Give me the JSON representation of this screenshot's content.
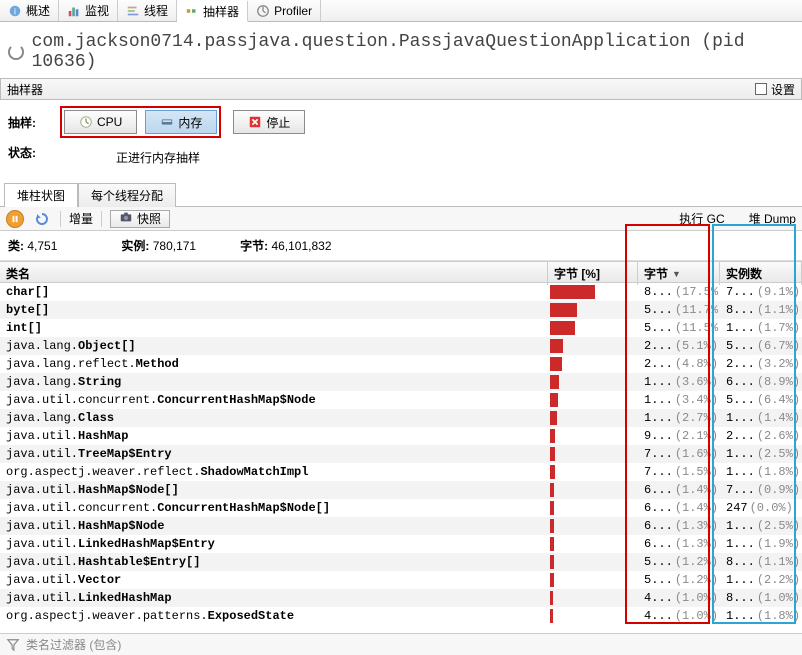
{
  "tabs": {
    "overview": "概述",
    "monitor": "监视",
    "threads": "线程",
    "sampler": "抽样器",
    "profiler": "Profiler"
  },
  "title": "com.jackson0714.passjava.question.PassjavaQuestionApplication (pid 10636)",
  "panel": {
    "name": "抽样器",
    "settings": "设置"
  },
  "controls": {
    "sample_label": "抽样:",
    "state_label": "状态:",
    "cpu": "CPU",
    "memory": "内存",
    "stop": "停止",
    "status": "正进行内存抽样"
  },
  "sub_tabs": {
    "histogram": "堆柱状图",
    "per_thread": "每个线程分配"
  },
  "toolbar": {
    "delta": "增量",
    "snapshot": "快照",
    "run_gc": "执行 GC",
    "heap_dump": "堆 Dump"
  },
  "totals": {
    "classes_label": "类:",
    "classes": "4,751",
    "instances_label": "实例:",
    "instances": "780,171",
    "bytes_label": "字节:",
    "bytes": "46,101,832"
  },
  "columns": {
    "name": "类名",
    "bytes_pct": "字节 [%]",
    "bytes": "字节",
    "instances": "实例数"
  },
  "footer": {
    "placeholder": "类名过滤器 (包含)"
  },
  "rows": [
    {
      "pkg": "",
      "cls": "char[]",
      "barPct": 50,
      "b": "8...",
      "bp": "(17.5%)",
      "i": "7...",
      "ip": "(9.1%)"
    },
    {
      "pkg": "",
      "cls": "byte[]",
      "barPct": 30,
      "b": "5...",
      "bp": "(11.7%)",
      "i": "8...",
      "ip": "(1.1%)"
    },
    {
      "pkg": "",
      "cls": "int[]",
      "barPct": 28,
      "b": "5...",
      "bp": "(11.5%)",
      "i": "1...",
      "ip": "(1.7%)"
    },
    {
      "pkg": "java.lang.",
      "cls": "Object[]",
      "barPct": 14,
      "b": "2...",
      "bp": "(5.1%)",
      "i": "5...",
      "ip": "(6.7%)"
    },
    {
      "pkg": "java.lang.reflect.",
      "cls": "Method",
      "barPct": 13,
      "b": "2...",
      "bp": "(4.8%)",
      "i": "2...",
      "ip": "(3.2%)"
    },
    {
      "pkg": "java.lang.",
      "cls": "String",
      "barPct": 10,
      "b": "1...",
      "bp": "(3.6%)",
      "i": "6...",
      "ip": "(8.9%)"
    },
    {
      "pkg": "java.util.concurrent.",
      "cls": "ConcurrentHashMap$Node",
      "barPct": 9,
      "b": "1...",
      "bp": "(3.4%)",
      "i": "5...",
      "ip": "(6.4%)"
    },
    {
      "pkg": "java.lang.",
      "cls": "Class",
      "barPct": 8,
      "b": "1...",
      "bp": "(2.7%)",
      "i": "1...",
      "ip": "(1.4%)"
    },
    {
      "pkg": "java.util.",
      "cls": "HashMap",
      "barPct": 6,
      "b": "9...",
      "bp": "(2.1%)",
      "i": "2...",
      "ip": "(2.6%)"
    },
    {
      "pkg": "java.util.",
      "cls": "TreeMap$Entry",
      "barPct": 5,
      "b": "7...",
      "bp": "(1.6%)",
      "i": "1...",
      "ip": "(2.5%)"
    },
    {
      "pkg": "org.aspectj.weaver.reflect.",
      "cls": "ShadowMatchImpl",
      "barPct": 5,
      "b": "7...",
      "bp": "(1.5%)",
      "i": "1...",
      "ip": "(1.8%)"
    },
    {
      "pkg": "java.util.",
      "cls": "HashMap$Node[]",
      "barPct": 4,
      "b": "6...",
      "bp": "(1.4%)",
      "i": "7...",
      "ip": "(0.9%)"
    },
    {
      "pkg": "java.util.concurrent.",
      "cls": "ConcurrentHashMap$Node[]",
      "barPct": 4,
      "b": "6...",
      "bp": "(1.4%)",
      "i": "247",
      "ip": "(0.0%)"
    },
    {
      "pkg": "java.util.",
      "cls": "HashMap$Node",
      "barPct": 4,
      "b": "6...",
      "bp": "(1.3%)",
      "i": "1...",
      "ip": "(2.5%)"
    },
    {
      "pkg": "java.util.",
      "cls": "LinkedHashMap$Entry",
      "barPct": 4,
      "b": "6...",
      "bp": "(1.3%)",
      "i": "1...",
      "ip": "(1.9%)"
    },
    {
      "pkg": "java.util.",
      "cls": "Hashtable$Entry[]",
      "barPct": 4,
      "b": "5...",
      "bp": "(1.2%)",
      "i": "8...",
      "ip": "(1.1%)"
    },
    {
      "pkg": "java.util.",
      "cls": "Vector",
      "barPct": 4,
      "b": "5...",
      "bp": "(1.2%)",
      "i": "1...",
      "ip": "(2.2%)"
    },
    {
      "pkg": "java.util.",
      "cls": "LinkedHashMap",
      "barPct": 3,
      "b": "4...",
      "bp": "(1.0%)",
      "i": "8...",
      "ip": "(1.0%)"
    },
    {
      "pkg": "org.aspectj.weaver.patterns.",
      "cls": "ExposedState",
      "barPct": 3,
      "b": "4...",
      "bp": "(1.0%)",
      "i": "1...",
      "ip": "(1.8%)"
    }
  ]
}
